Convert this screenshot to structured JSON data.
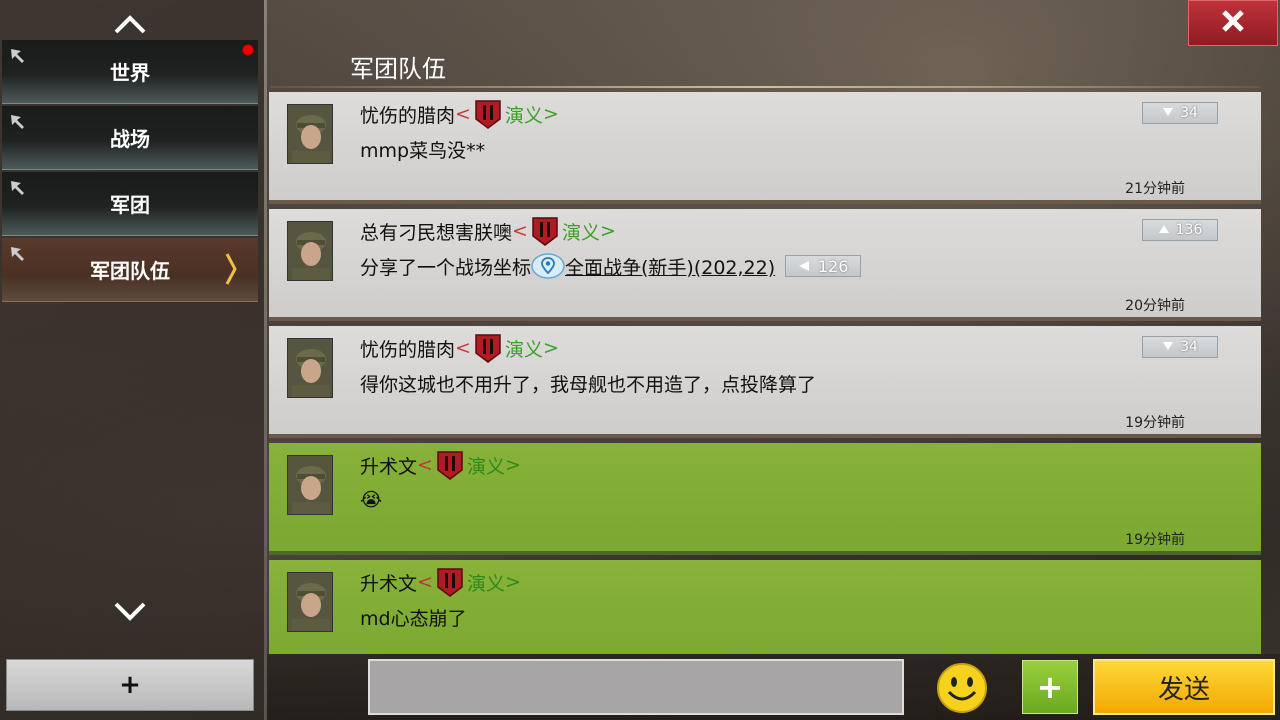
{
  "sidebar": {
    "tabs": [
      {
        "label": "世界",
        "has_notification": true
      },
      {
        "label": "战场",
        "has_notification": false
      },
      {
        "label": "军团",
        "has_notification": false
      },
      {
        "label": "军团队伍",
        "has_notification": false,
        "active": true
      }
    ],
    "add_label": "+"
  },
  "header": {
    "title": "军团队伍",
    "close_icon": "close-icon"
  },
  "messages": [
    {
      "name": "忧伤的腊肉",
      "bracket_open": "<",
      "corps": "演义",
      "bracket_close": ">",
      "text": "mmp菜鸟没**",
      "time": "21分钟前",
      "rank": "34",
      "rank_dir": "down",
      "style": "gray"
    },
    {
      "name": "总有刁民想害朕噢",
      "bracket_open": "<",
      "corps": "演义",
      "bracket_close": ">",
      "text_prefix": "分享了一个战场坐标",
      "coord_text": "全面战争(新手)(202,22)",
      "coord_value": "126",
      "time": "20分钟前",
      "rank": "136",
      "rank_dir": "up",
      "style": "gray"
    },
    {
      "name": "忧伤的腊肉",
      "bracket_open": "<",
      "corps": "演义",
      "bracket_close": ">",
      "text": "得你这城也不用升了，我母舰也不用造了，点投降算了",
      "time": "19分钟前",
      "rank": "34",
      "rank_dir": "down",
      "style": "gray"
    },
    {
      "name": "升术文",
      "bracket_open": "<",
      "corps": "演义",
      "bracket_close": ">",
      "text": "😭",
      "time": "19分钟前",
      "style": "green"
    },
    {
      "name": "升术文",
      "bracket_open": "<",
      "corps": "演义",
      "bracket_close": ">",
      "text": "md心态崩了",
      "time": "",
      "style": "green"
    }
  ],
  "input": {
    "value": "",
    "placeholder": ""
  },
  "attach_label": "+",
  "send_label": "发送",
  "colors": {
    "green_message": "#7fac34",
    "gray_message": "#d6d4d2",
    "send_button": "#f5b800",
    "close_button": "#a8262e",
    "corps_text": "#3aa02a"
  }
}
